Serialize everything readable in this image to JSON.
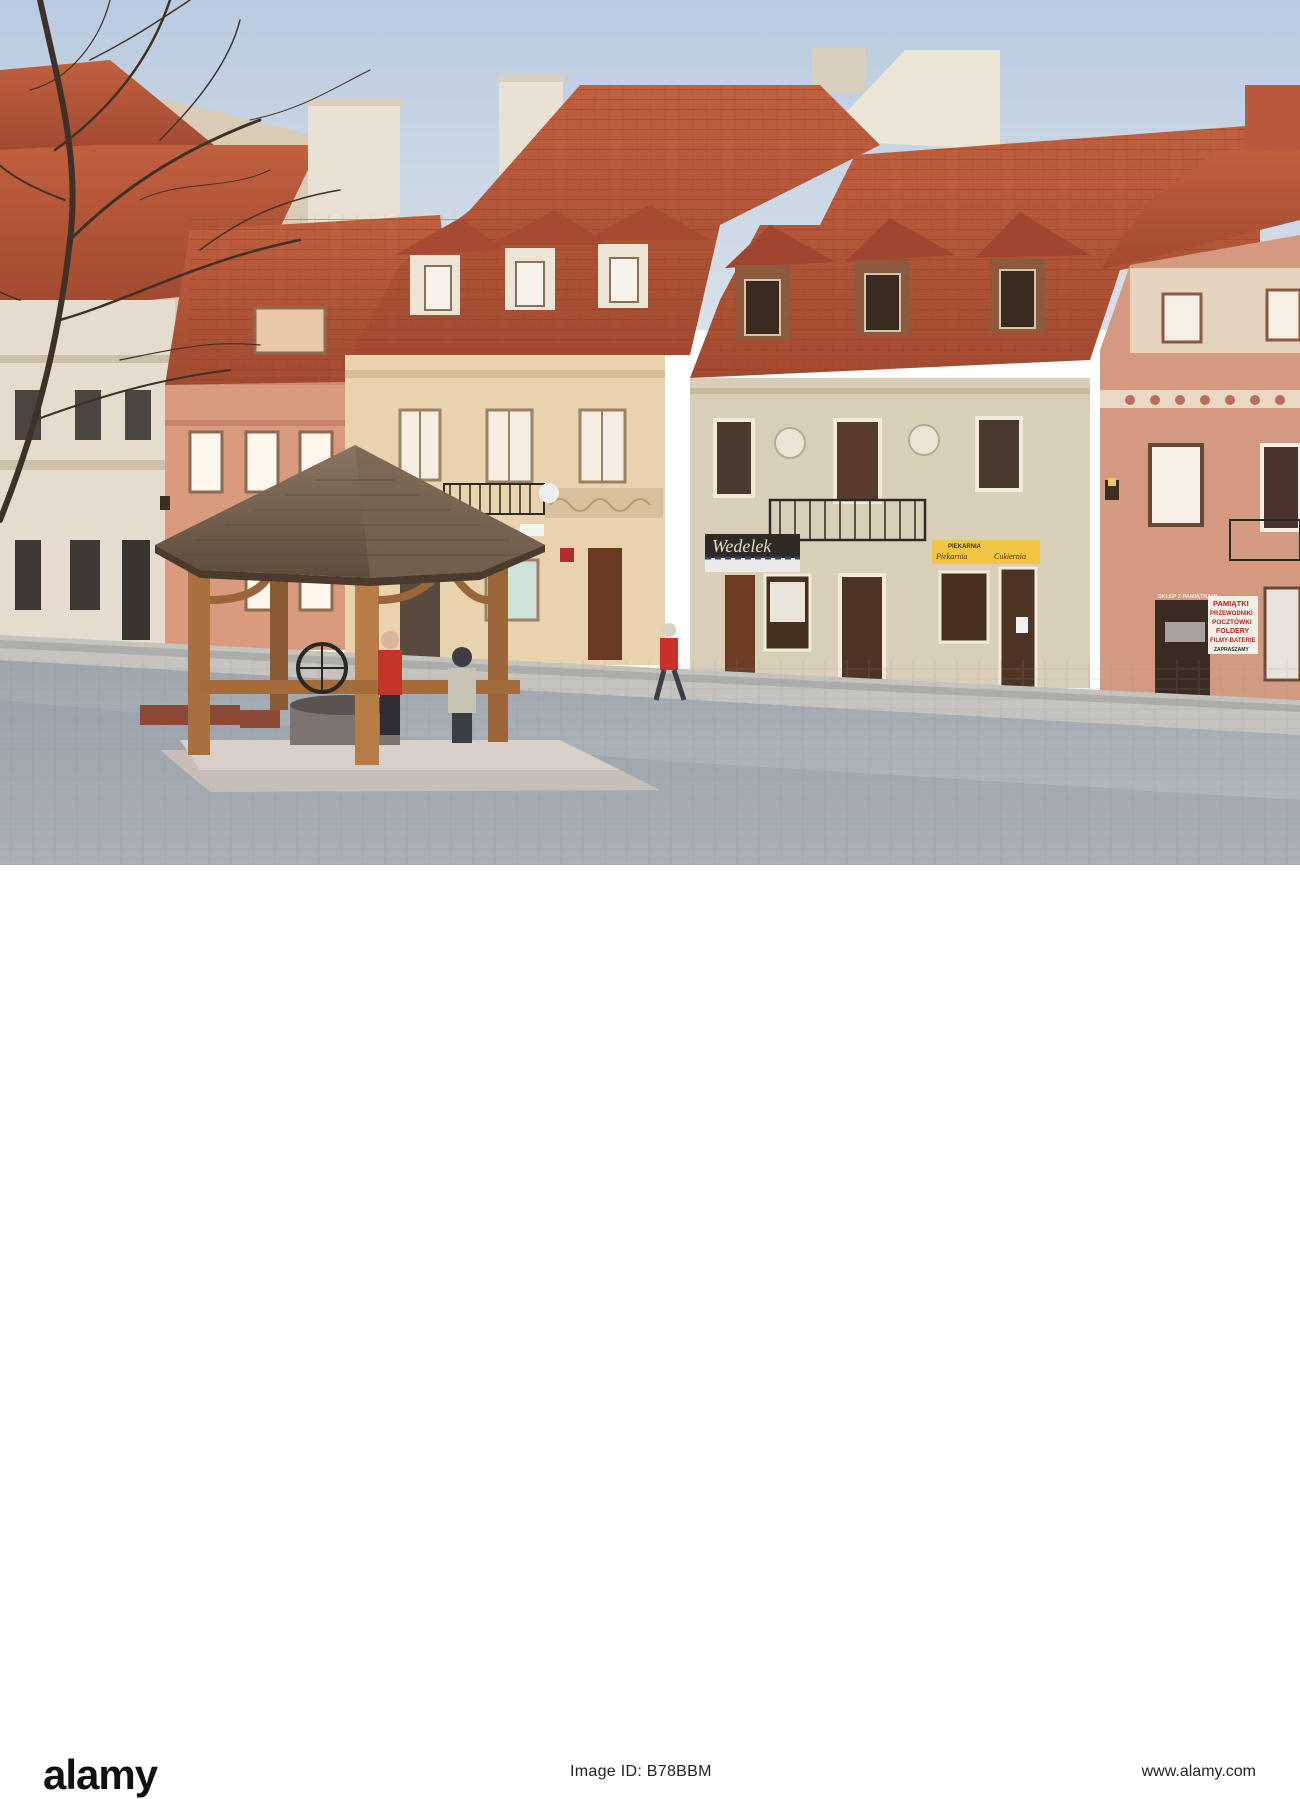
{
  "photo": {
    "alt_text": "",
    "signs": {
      "bakery": "Wedelek",
      "pastry_shop_top": "PIEKARNIA",
      "pastry_shop_left": "Piekarnia",
      "pastry_shop_right": "Cukiernia",
      "shop_panel_top": "SKLEP Z PAMIĄTKAMI",
      "souvenir_line1": "PAMIĄTKI",
      "souvenir_line2": "PRZEWODNIKI",
      "souvenir_line3": "POCZTÓWKI",
      "souvenir_line4": "FOLDERY",
      "souvenir_line5": "FILMY-BATERIE",
      "souvenir_line6": "ZAPRASZAMY"
    }
  },
  "banner": {
    "logo_text": "alamy",
    "image_id": "Image ID: B78BBM",
    "website": "www.alamy.com"
  },
  "colors": {
    "sky": "#c9d6e4",
    "roof": "#b5553a",
    "square": "#aab2bb",
    "logo": "#111111"
  }
}
